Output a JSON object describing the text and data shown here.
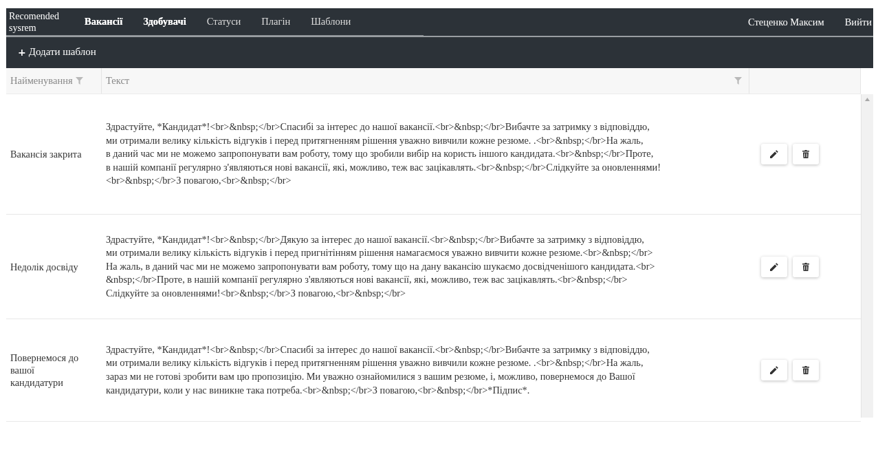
{
  "navbar": {
    "brand": "Recomended sysrem",
    "items": [
      {
        "label": "Вакансії",
        "highlighted": true
      },
      {
        "label": "Здобувачі",
        "highlighted": true
      },
      {
        "label": "Статуси",
        "highlighted": false
      },
      {
        "label": "Плагін",
        "highlighted": false
      },
      {
        "label": "Шаблони",
        "highlighted": false
      }
    ],
    "user": "Стеценко Максим",
    "logout": "Вийти"
  },
  "toolbar": {
    "add_button": {
      "icon": "+",
      "label": "Додати шаблон"
    }
  },
  "table": {
    "columns": [
      {
        "label": "Найменування",
        "filter": true
      },
      {
        "label": "Текст",
        "filter": true
      }
    ],
    "rows": [
      {
        "name": "Вакансія закрита",
        "text": [
          "Здрастуйте, *Кандидат*!<br>&nbsp;</br>Спасибі за інтерес до нашої вакансії.<br>&nbsp;</br>Вибачте за затримку з відповіддю,",
          "ми отримали велику кількість відгуків і перед притягненням рішення уважно вивчили кожне резюме. .<br>&nbsp;</br>На жаль,",
          "в даний час ми не можемо запропонувати вам роботу, тому що зробили вибір на користь іншого кандидата.<br>&nbsp;</br>Проте,",
          "в нашій компанії регулярно з'являються нові вакансії, які, можливо, теж вас зацікавлять.<br>&nbsp;</br>Слідкуйте за оновленнями!",
          "<br>&nbsp;</br>З повагою,<br>&nbsp;</br>"
        ]
      },
      {
        "name": "Недолік досвіду",
        "text": [
          "Здрастуйте, *Кандидат*!<br>&nbsp;</br>Дякую за інтерес до нашої вакансії.<br>&nbsp;</br>Вибачте за затримку з відповіддю,",
          "ми отримали велику кількість відгуків і перед пригнітінням рішення намагаємося уважно вивчити кожне резюме.<br>&nbsp;</br>",
          "На жаль, в даний час ми не можемо запропонувати вам роботу, тому що на дану вакансію шукаємо досвідченішого кандидата.<br>",
          "&nbsp;</br>Проте, в нашій компанії регулярно з'являються нові вакансії, які, можливо, теж вас зацікавлять.<br>&nbsp;</br>",
          "Слідкуйте за оновленнями!<br>&nbsp;</br>З повагою,<br>&nbsp;</br>"
        ]
      },
      {
        "name": "Повернемося до вашої кандидатури",
        "text": [
          "Здрастуйте, *Кандидат*!<br>&nbsp;</br>Спасибі за інтерес до нашої вакансії.<br>&nbsp;</br>Вибачте за затримку з відповіддю,",
          "ми отримали велику кількість відгуків і перед притягненням рішення уважно вивчили кожне резюме. .<br>&nbsp;</br>На жаль,",
          " зараз ми не готові зробити вам цю пропозицію. Ми уважно ознайомилися з вашим резюме, і, можливо, повернемося до Вашої",
          "кандидатури, коли у нас виникне така потреба.<br>&nbsp;</br>З повагою,<br>&nbsp;</br>*Підпис*."
        ]
      }
    ]
  }
}
